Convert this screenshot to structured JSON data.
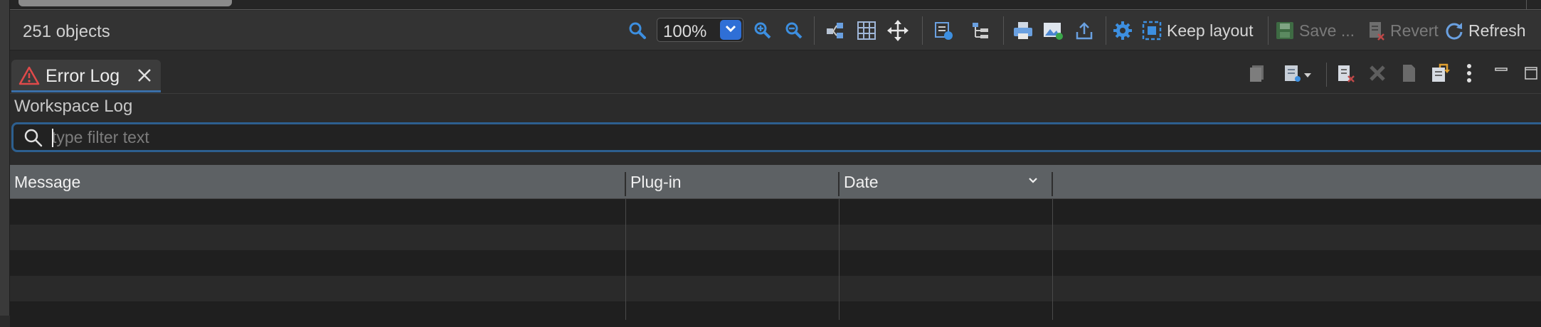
{
  "status": {
    "object_count": "251 objects",
    "zoom_level": "100%",
    "keep_layout_label": "Keep layout",
    "save_label": "Save ...",
    "revert_label": "Revert",
    "refresh_label": "Refresh"
  },
  "view": {
    "tab_label": "Error Log",
    "log_name": "Workspace Log"
  },
  "filter": {
    "placeholder": "type filter text",
    "value": ""
  },
  "table": {
    "columns": [
      "Message",
      "Plug-in",
      "Date"
    ],
    "sorted_column": "Date",
    "sort_direction": "descending",
    "row_count": 5
  },
  "colors": {
    "accent": "#2f6fd6",
    "focus_border": "#2d5f8f",
    "tab_underline": "#3a6fa8",
    "header_bg": "#5d6164",
    "warning": "#e04a4a"
  }
}
